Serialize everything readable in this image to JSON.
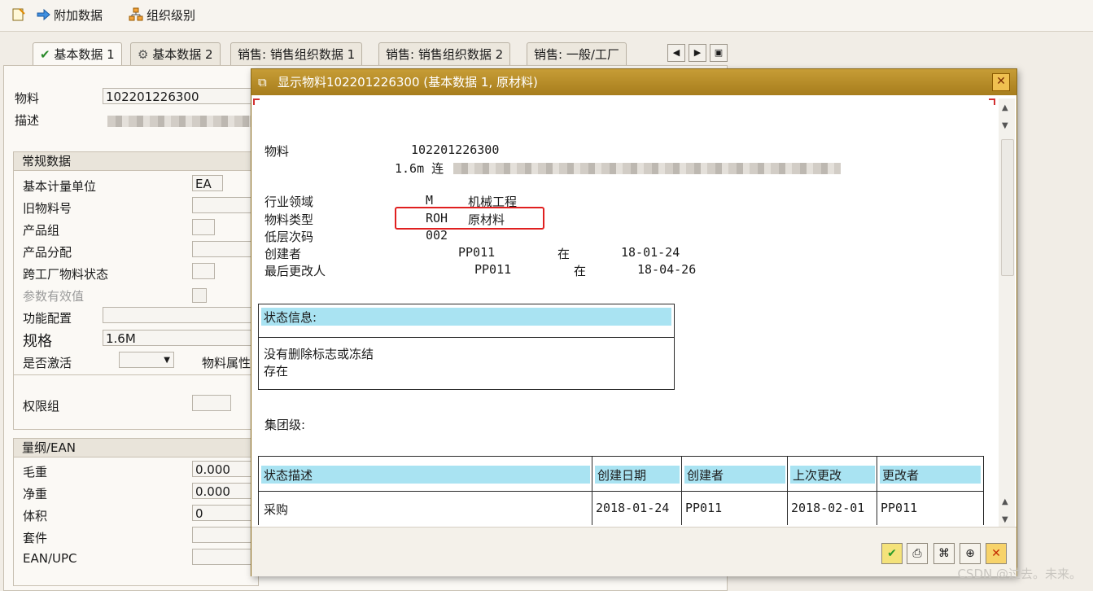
{
  "toolbar": {
    "additional_data": "附加数据",
    "org_levels": "组织级别"
  },
  "tabs": [
    {
      "label": "基本数据 1"
    },
    {
      "label": "基本数据 2"
    },
    {
      "label": "销售: 销售组织数据 1"
    },
    {
      "label": "销售: 销售组织数据 2"
    },
    {
      "label": "销售: 一般/工厂"
    }
  ],
  "form": {
    "material_label": "物料",
    "material_value": "102201226300",
    "desc_label": "描述",
    "general_group_title": "常规数据",
    "base_uom_label": "基本计量单位",
    "base_uom_value": "EA",
    "old_material_label": "旧物料号",
    "product_group_label": "产品组",
    "product_alloc_label": "产品分配",
    "xplant_status_label": "跨工厂物料状态",
    "param_valid_label": "参数有效值",
    "func_config_label": "功能配置",
    "spec_label": "规格",
    "spec_value": "1.6M",
    "active_label": "是否激活",
    "material_attr_label": "物料属性",
    "auth_group_label": "权限组",
    "dims_group_title": "量纲/EAN",
    "gross_weight_label": "毛重",
    "gross_weight_value": "0.000",
    "net_weight_label": "净重",
    "net_weight_value": "0.000",
    "volume_label": "体积",
    "volume_value": "0",
    "kit_label": "套件",
    "ean_label": "EAN/UPC"
  },
  "dialog": {
    "title": "显示物料102201226300 (基本数据 1, 原材料)",
    "material_label": "物料",
    "material_number": "102201226300",
    "material_desc_prefix": "1.6m 连",
    "industry_label": "行业领域",
    "industry_code": "M",
    "industry_text": "机械工程",
    "type_label": "物料类型",
    "type_code": "ROH",
    "type_text": "原材料",
    "llc_label": "低层次码",
    "llc_value": "002",
    "creator_label": "创建者",
    "creator_value": "PP011",
    "at_word": "在",
    "created_date": "18-01-24",
    "changer_label": "最后更改人",
    "changer_value": "PP011",
    "changed_date": "18-04-26",
    "status_info_header": "状态信息:",
    "status_line1": "没有删除标志或冻结",
    "status_line2": "存在",
    "client_level_label": "集团级:",
    "table": {
      "headers": [
        "状态描述",
        "创建日期",
        "创建者",
        "上次更改",
        "更改者"
      ],
      "rows": [
        [
          "采购",
          "2018-01-24",
          "PP011",
          "2018-02-01",
          "PP011"
        ]
      ]
    }
  },
  "footer": {
    "watermark": "CSDN @过去。未来。"
  },
  "colors": {
    "dialog_title": "#b88c28",
    "highlight_cyan": "#a9e3f2",
    "annotation_red": "#e02020"
  }
}
